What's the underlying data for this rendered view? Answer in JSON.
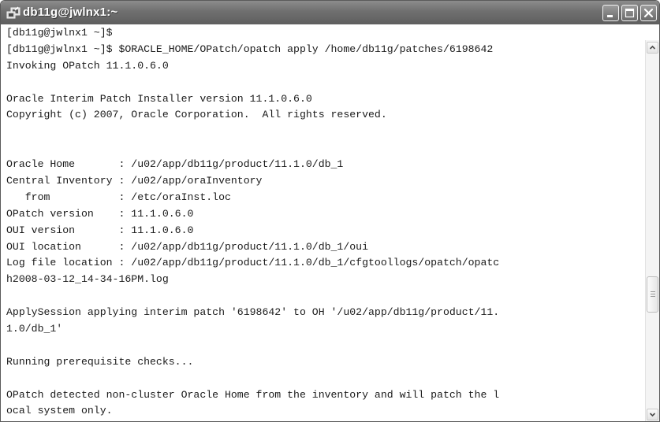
{
  "window": {
    "title": "db11g@jwlnx1:~",
    "icon": "putty-terminal-icon",
    "controls": [
      "minimize",
      "maximize",
      "close"
    ]
  },
  "terminal": {
    "lines": [
      "[db11g@jwlnx1 ~]$",
      "[db11g@jwlnx1 ~]$ $ORACLE_HOME/OPatch/opatch apply /home/db11g/patches/6198642",
      "Invoking OPatch 11.1.0.6.0",
      "",
      "Oracle Interim Patch Installer version 11.1.0.6.0",
      "Copyright (c) 2007, Oracle Corporation.  All rights reserved.",
      "",
      "",
      "Oracle Home       : /u02/app/db11g/product/11.1.0/db_1",
      "Central Inventory : /u02/app/oraInventory",
      "   from           : /etc/oraInst.loc",
      "OPatch version    : 11.1.0.6.0",
      "OUI version       : 11.1.0.6.0",
      "OUI location      : /u02/app/db11g/product/11.1.0/db_1/oui",
      "Log file location : /u02/app/db11g/product/11.1.0/db_1/cfgtoollogs/opatch/opatc",
      "h2008-03-12_14-34-16PM.log",
      "",
      "ApplySession applying interim patch '6198642' to OH '/u02/app/db11g/product/11.",
      "1.0/db_1'",
      "",
      "Running prerequisite checks...",
      "",
      "OPatch detected non-cluster Oracle Home from the inventory and will patch the l",
      "ocal system only."
    ]
  },
  "scrollbar": {
    "position_fraction": 0.7
  }
}
